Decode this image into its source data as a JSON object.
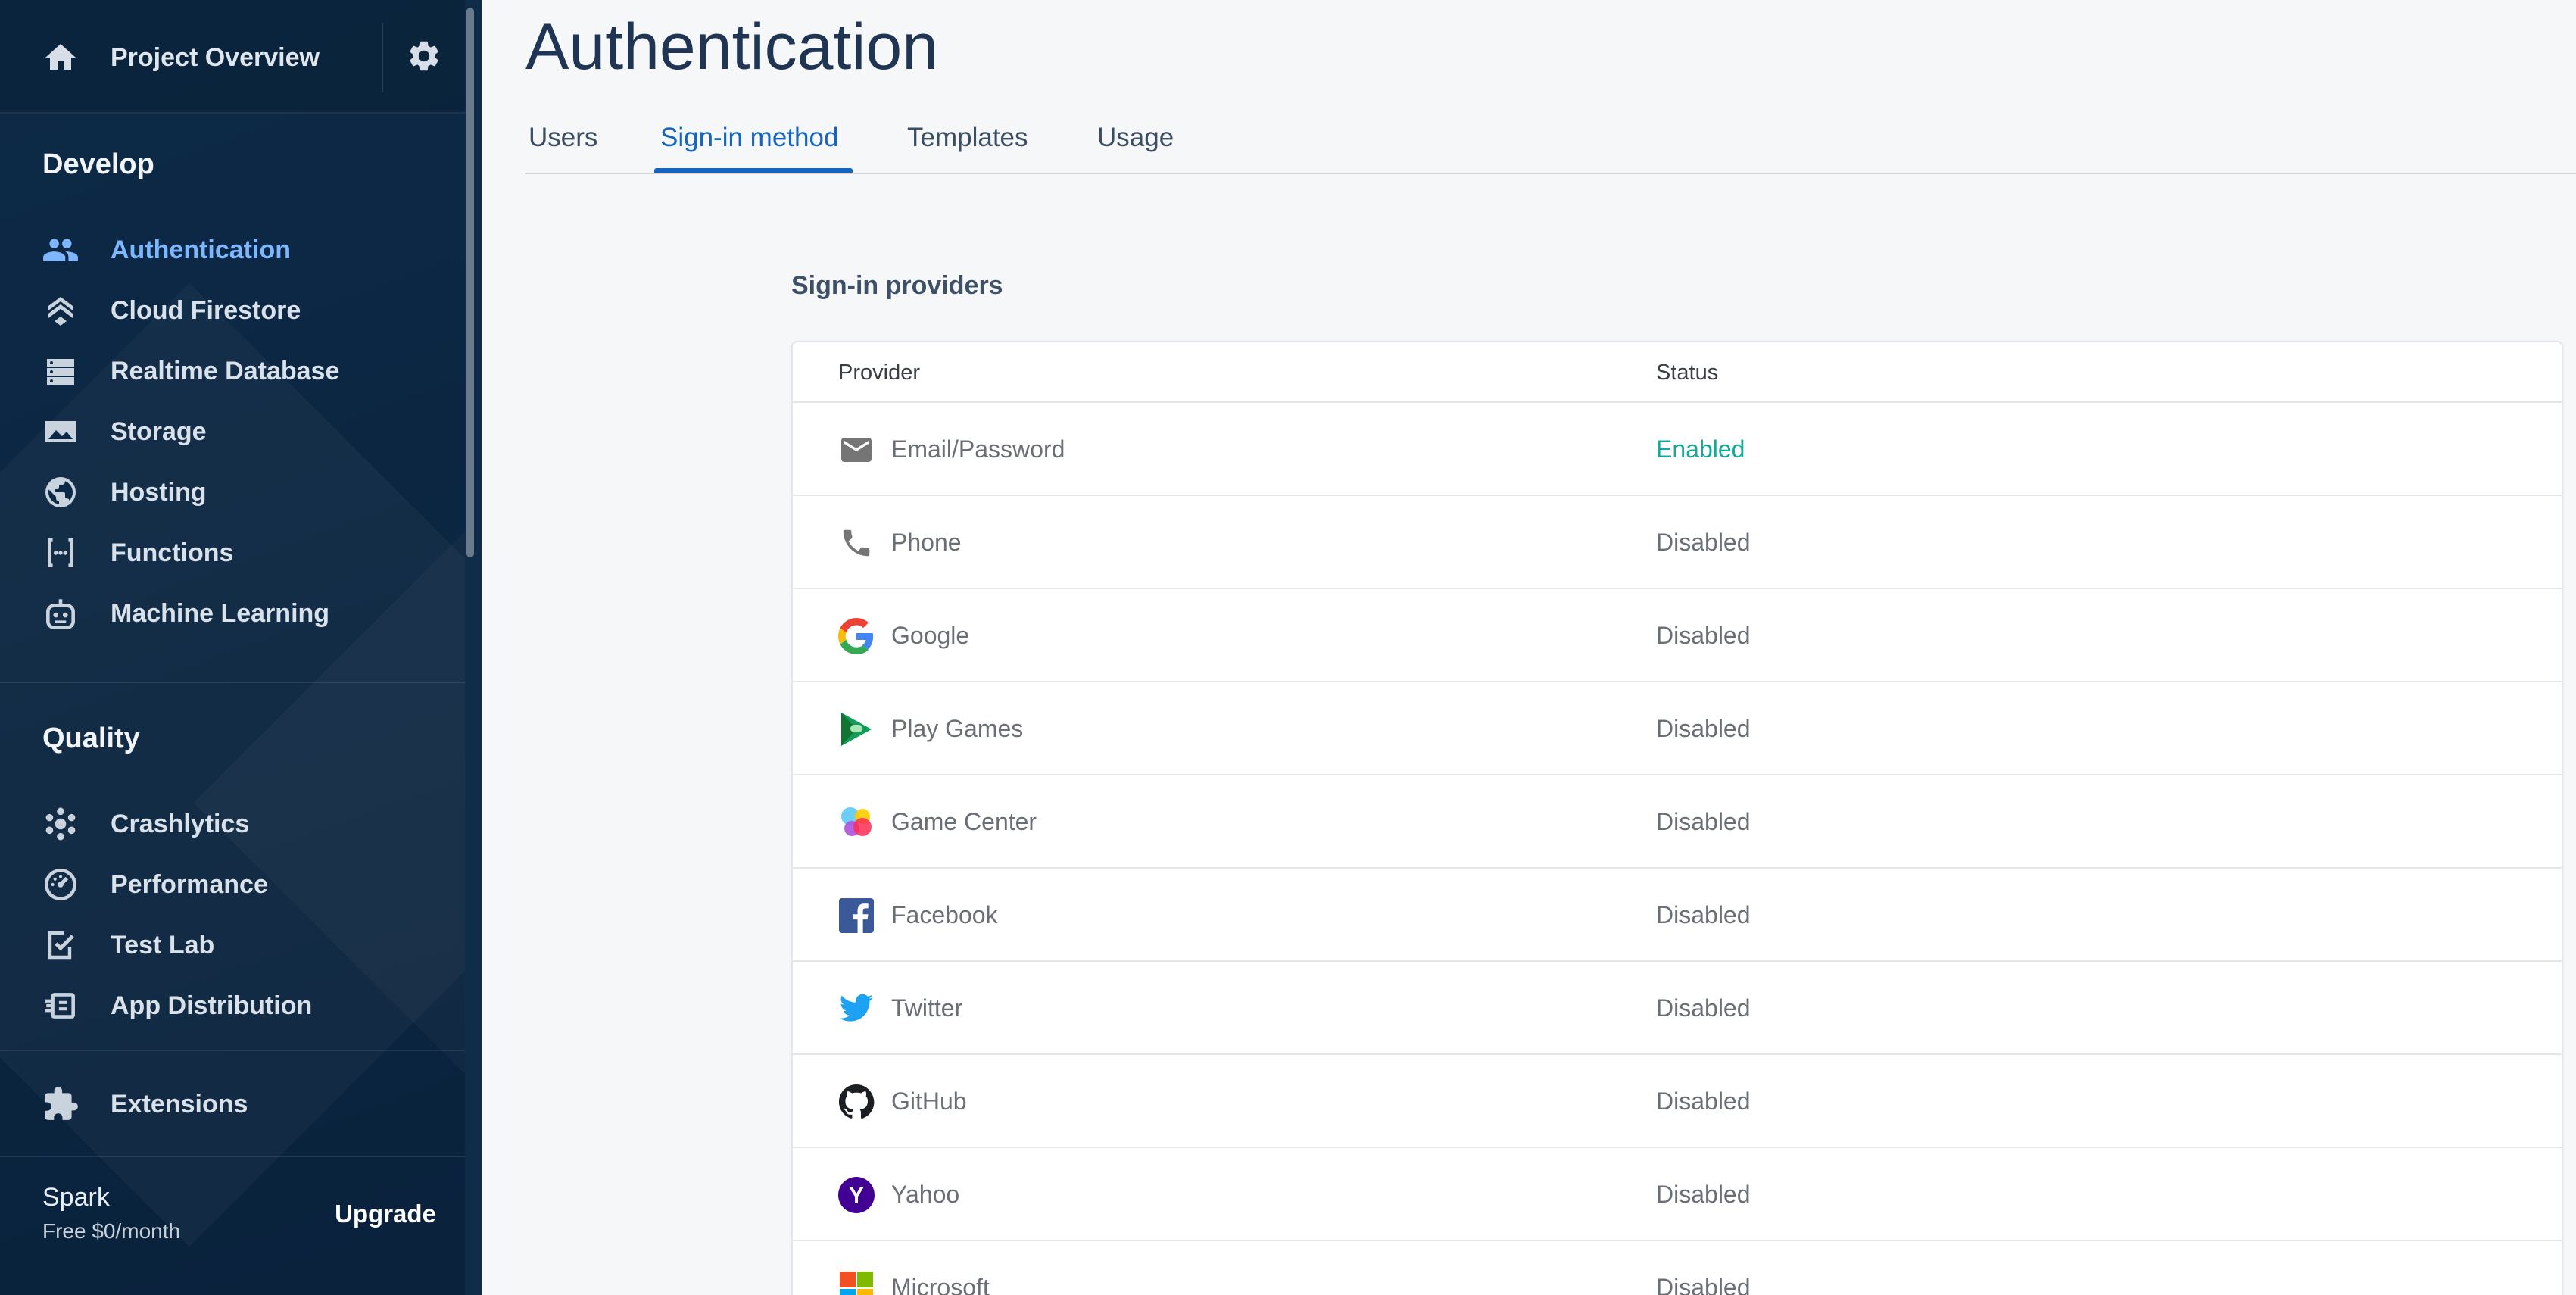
{
  "sidebar": {
    "project_title": "Project Overview",
    "sections": {
      "develop": "Develop",
      "quality": "Quality"
    },
    "develop_items": [
      {
        "label": "Authentication",
        "icon": "people-icon",
        "active": true
      },
      {
        "label": "Cloud Firestore",
        "icon": "firestore-icon"
      },
      {
        "label": "Realtime Database",
        "icon": "database-icon"
      },
      {
        "label": "Storage",
        "icon": "storage-image-icon"
      },
      {
        "label": "Hosting",
        "icon": "globe-icon"
      },
      {
        "label": "Functions",
        "icon": "functions-icon"
      },
      {
        "label": "Machine Learning",
        "icon": "robot-icon"
      }
    ],
    "quality_items": [
      {
        "label": "Crashlytics",
        "icon": "crashlytics-icon"
      },
      {
        "label": "Performance",
        "icon": "gauge-icon"
      },
      {
        "label": "Test Lab",
        "icon": "test-lab-icon"
      },
      {
        "label": "App Distribution",
        "icon": "app-distribution-icon"
      }
    ],
    "extensions": {
      "label": "Extensions",
      "icon": "puzzle-icon"
    },
    "plan": {
      "name": "Spark",
      "price": "Free $0/month",
      "upgrade_label": "Upgrade"
    }
  },
  "main": {
    "title": "Authentication",
    "tabs": [
      {
        "label": "Users"
      },
      {
        "label": "Sign-in method",
        "active": true
      },
      {
        "label": "Templates"
      },
      {
        "label": "Usage"
      }
    ],
    "providers_title": "Sign-in providers",
    "table": {
      "columns": [
        "Provider",
        "Status"
      ],
      "rows": [
        {
          "provider": "Email/Password",
          "status": "Enabled",
          "icon": "email-icon"
        },
        {
          "provider": "Phone",
          "status": "Disabled",
          "icon": "phone-icon"
        },
        {
          "provider": "Google",
          "status": "Disabled",
          "icon": "google-icon"
        },
        {
          "provider": "Play Games",
          "status": "Disabled",
          "icon": "play-games-icon"
        },
        {
          "provider": "Game Center",
          "status": "Disabled",
          "icon": "game-center-icon"
        },
        {
          "provider": "Facebook",
          "status": "Disabled",
          "icon": "facebook-icon"
        },
        {
          "provider": "Twitter",
          "status": "Disabled",
          "icon": "twitter-icon"
        },
        {
          "provider": "GitHub",
          "status": "Disabled",
          "icon": "github-icon"
        },
        {
          "provider": "Yahoo",
          "status": "Disabled",
          "icon": "yahoo-icon"
        },
        {
          "provider": "Microsoft",
          "status": "Disabled",
          "icon": "microsoft-icon"
        }
      ]
    }
  },
  "colors": {
    "sidebar_bg": "#0b2540",
    "active_nav": "#7db7ff",
    "tab_active": "#1565c0",
    "enabled_status": "#16a99a"
  }
}
